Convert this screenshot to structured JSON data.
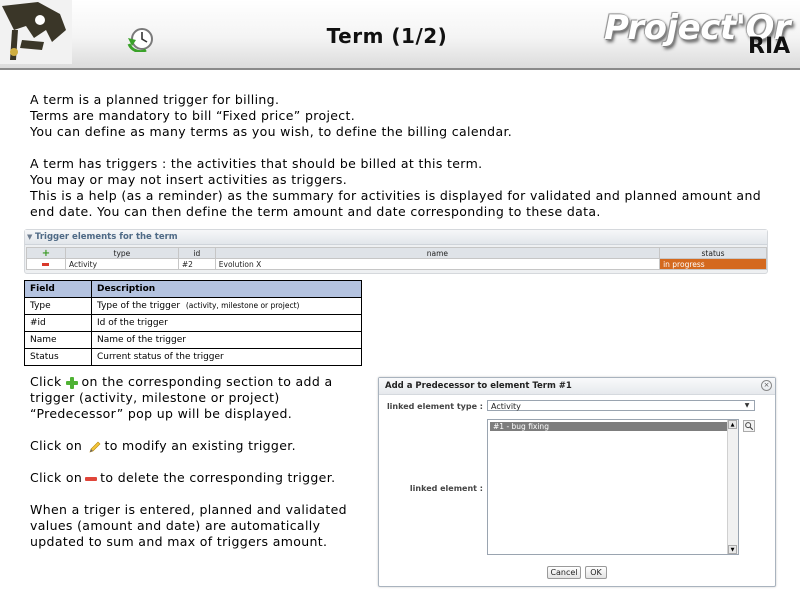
{
  "header": {
    "title": "Term (1/2)",
    "brand_main": "Project'Or",
    "brand_sub": "RIA"
  },
  "intro_lines": [
    "A term is a planned trigger for billing.",
    "Terms are mandatory to bill “Fixed price” project.",
    "You can define as many terms as you wish, to define the billing calendar."
  ],
  "trigger_lines": [
    "A term has triggers : the activities that should be billed at this term.",
    "You may or may not insert activities as triggers.",
    "This is a help (as a reminder) as the summary for activities is displayed for validated and planned amount and end date. You can then define the term amount and date corresponding to these data."
  ],
  "trigger_panel": {
    "title": "Trigger elements for the term",
    "columns": [
      "type",
      "id",
      "name",
      "status"
    ],
    "rows": [
      {
        "type": "Activity",
        "id": "#2",
        "name": "Evolution X",
        "status": "in progress"
      }
    ],
    "status_color": "#d4691e"
  },
  "field_table": {
    "headers": [
      "Field",
      "Description"
    ],
    "rows": [
      {
        "field": "Type",
        "desc": "Type of the trigger",
        "note": "(activity, milestone or project)"
      },
      {
        "field": "#id",
        "desc": "Id of the trigger"
      },
      {
        "field": "Name",
        "desc": "Name of the trigger"
      },
      {
        "field": "Status",
        "desc": "Current status of the trigger"
      }
    ]
  },
  "help": {
    "add_before": "Click",
    "add_after": "on the corresponding section to add a trigger (activity, milestone or project) “Predecessor” pop up will be displayed.",
    "modify_before": "Click on",
    "modify_after": "to modify an existing trigger.",
    "delete_before": "Click on",
    "delete_after": "to delete the corresponding trigger.",
    "final": "When a triger is entered, planned and validated values (amount and date) are automatically updated to sum and max of triggers amount."
  },
  "dialog": {
    "title": "Add a Predecessor to element Term #1",
    "type_label": "linked element type :",
    "type_value": "Activity",
    "element_label": "linked element :",
    "options": [
      "#1 - bug fixing"
    ],
    "cancel_label": "Cancel",
    "ok_label": "OK"
  },
  "icons": [
    "logo-icon",
    "refresh-clock-icon",
    "add-icon",
    "remove-icon",
    "edit-icon",
    "delete-icon",
    "close-icon",
    "search-icon"
  ],
  "colors": {
    "accent_green": "#4fb234",
    "delete_red": "#e0463a",
    "table_header": "#b4c3e0"
  }
}
